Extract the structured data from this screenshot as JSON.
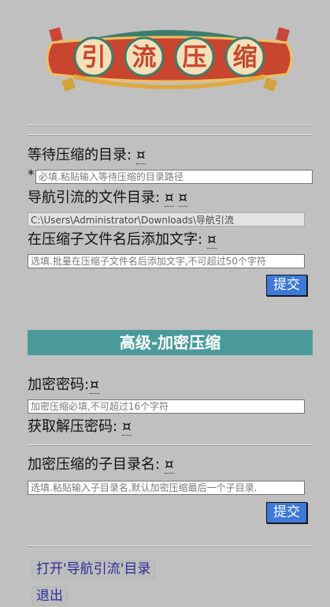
{
  "logo": {
    "text": "引流压缩",
    "chars": [
      "引",
      "流",
      "压",
      "缩"
    ]
  },
  "form1": {
    "target_dir_label": "等待压缩的目录:",
    "help_marker": "¤",
    "required_marker": "*",
    "target_dir_placeholder": "必填.粘贴输入等待压缩的目录路径",
    "nav_dir_label": "导航引流的文件目录:",
    "nav_dir_value": "C:\\Users\\Administrator\\Downloads\\导航引流",
    "suffix_label": "在压缩子文件名后添加文字:",
    "suffix_placeholder": "选填.批量在压缩子文件名后添加文字,不可超过50个字符",
    "submit_label": "提交"
  },
  "advanced": {
    "title": "高级-加密压缩",
    "password_label": "加密密码:",
    "password_placeholder": "加密压缩必填,不可超过16个字符",
    "get_password_label": "获取解压密码:",
    "subdir_label": "加密压缩的子目录名:",
    "subdir_placeholder": "选填.粘贴输入子目录名,默认加密压缩最后一个子目录.",
    "submit_label": "提交"
  },
  "footer": {
    "open_dir_label": "打开'导航引流'目录",
    "exit_label": "退出"
  },
  "colors": {
    "background": "#c0c0c0",
    "banner": "#4a9a9c",
    "submit": "#3c79d8",
    "link_text": "#2a2a9a"
  }
}
